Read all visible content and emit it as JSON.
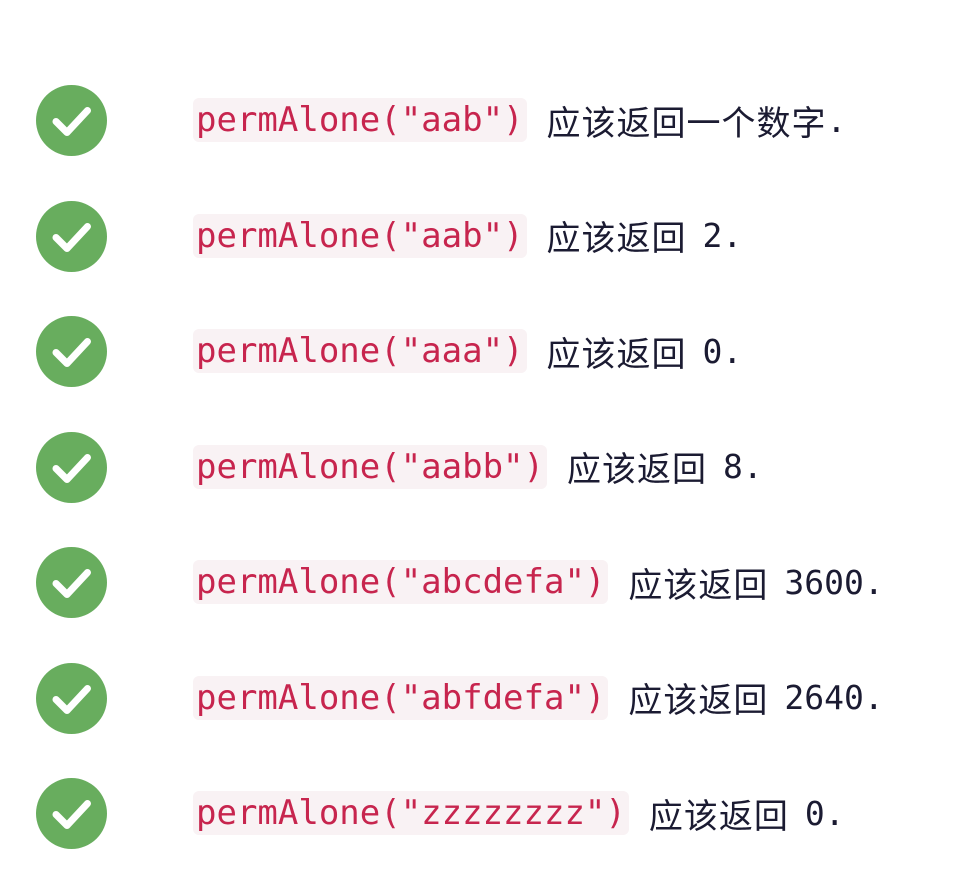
{
  "tests": [
    {
      "status": "passed",
      "icon": "check-circle-icon",
      "code": "permAlone(\"aab\")",
      "label": "应该返回一个数字",
      "value": "."
    },
    {
      "status": "passed",
      "icon": "check-circle-icon",
      "code": "permAlone(\"aab\")",
      "label": "应该返回",
      "value": "2."
    },
    {
      "status": "passed",
      "icon": "check-circle-icon",
      "code": "permAlone(\"aaa\")",
      "label": "应该返回",
      "value": "0."
    },
    {
      "status": "passed",
      "icon": "check-circle-icon",
      "code": "permAlone(\"aabb\")",
      "label": "应该返回",
      "value": "8."
    },
    {
      "status": "passed",
      "icon": "check-circle-icon",
      "code": "permAlone(\"abcdefa\")",
      "label": "应该返回",
      "value": "3600."
    },
    {
      "status": "passed",
      "icon": "check-circle-icon",
      "code": "permAlone(\"abfdefa\")",
      "label": "应该返回",
      "value": "2640."
    },
    {
      "status": "passed",
      "icon": "check-circle-icon",
      "code": "permAlone(\"zzzzzzzz\")",
      "label": "应该返回",
      "value": "0."
    }
  ],
  "colors": {
    "check_fill": "#68ad5e",
    "check_mark": "#ffffff",
    "code_text": "#c7254e",
    "code_background": "#f9f2f4",
    "body_text": "#1b1b32"
  }
}
